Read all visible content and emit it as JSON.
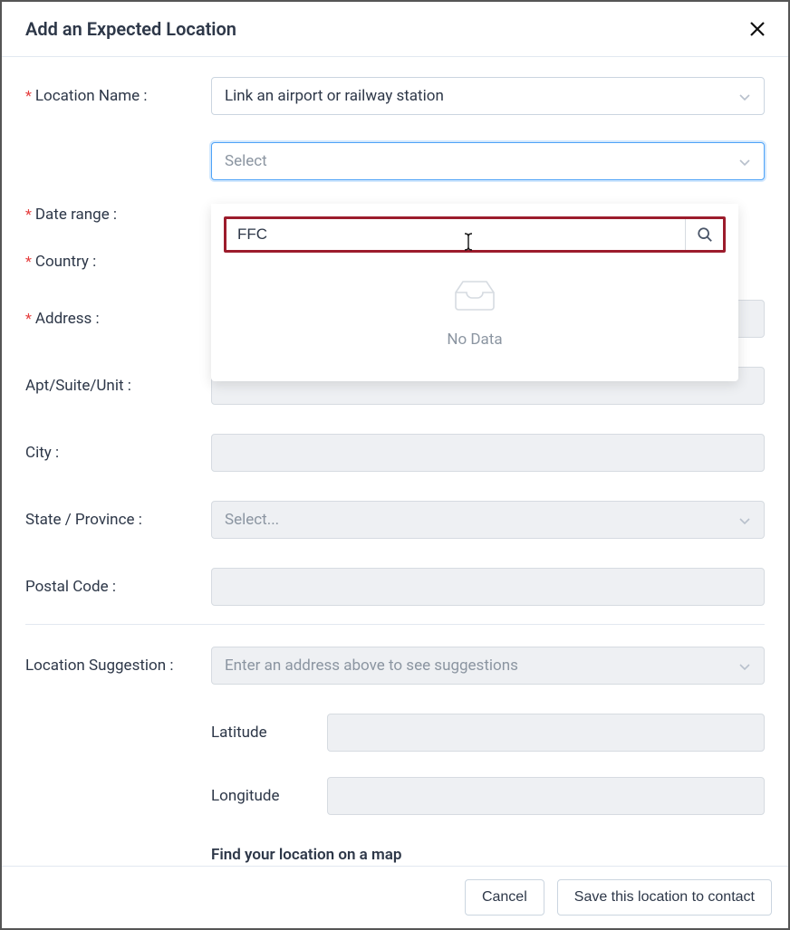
{
  "header": {
    "title": "Add an Expected Location"
  },
  "fields": {
    "location_name": {
      "label": "Location Name :",
      "select_value": "Link an airport or railway station",
      "subselect_placeholder": "Select",
      "search_value": "FFC",
      "empty_text": "No Data"
    },
    "date_range": {
      "label": "Date range :"
    },
    "country": {
      "label": "Country :"
    },
    "address": {
      "label": "Address :"
    },
    "apt": {
      "label": "Apt/Suite/Unit :"
    },
    "city": {
      "label": "City :"
    },
    "state": {
      "label": "State / Province :",
      "placeholder": "Select..."
    },
    "postal": {
      "label": "Postal Code :"
    },
    "suggestion": {
      "label": "Location Suggestion :",
      "placeholder": "Enter an address above to see suggestions"
    },
    "latitude": {
      "label": "Latitude"
    },
    "longitude": {
      "label": "Longitude"
    },
    "map_link": "Find your location on a map"
  },
  "footer": {
    "cancel": "Cancel",
    "save": "Save this location to contact"
  }
}
